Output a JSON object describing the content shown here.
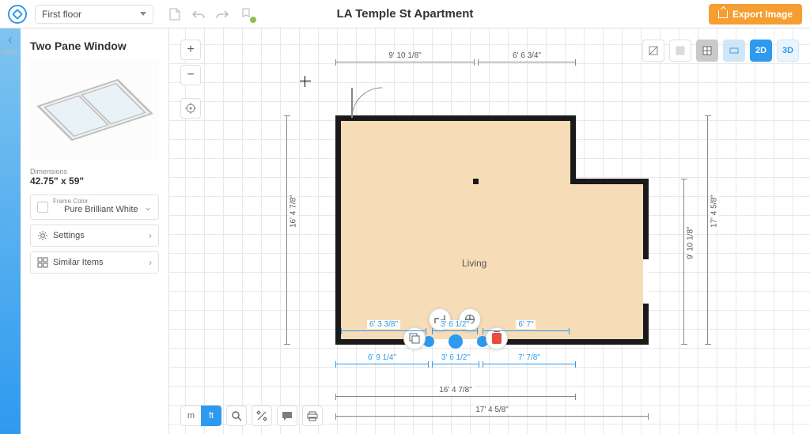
{
  "header": {
    "floor_selector": "First floor",
    "document_title": "LA Temple St Apartment",
    "export_label": "Export Image"
  },
  "back": {
    "label": "Back"
  },
  "props": {
    "title": "Two Pane Window",
    "dimensions_label": "Dimensions",
    "dimensions_value": "42.75\" x 59\"",
    "frame_color_label": "Frame Color",
    "frame_color_value": "Pure Brilliant White",
    "settings_label": "Settings",
    "similar_label": "Similar Items"
  },
  "view": {
    "mode_2d": "2D",
    "mode_3d": "3D"
  },
  "units": {
    "m": "m",
    "ft": "ft"
  },
  "plan": {
    "room_name": "Living",
    "dims": {
      "top_left": "9' 10 1/8\"",
      "top_right": "6' 6 3/4\"",
      "left": "16' 4 7/8\"",
      "right_upper": "17' 4 5/8\"",
      "right_lower": "9' 10 1/8\"",
      "inner_bottom_a": "6' 3 3/8\"",
      "inner_bottom_b": "3' 6 1/2\"",
      "inner_bottom_c": "6' 7\"",
      "outer_bottom_a": "6' 9 1/4\"",
      "outer_bottom_b": "3' 6 1/2\"",
      "outer_bottom_c": "7' 7/8\"",
      "overall_a": "16' 4 7/8\"",
      "overall_b": "17' 4 5/8\""
    }
  }
}
